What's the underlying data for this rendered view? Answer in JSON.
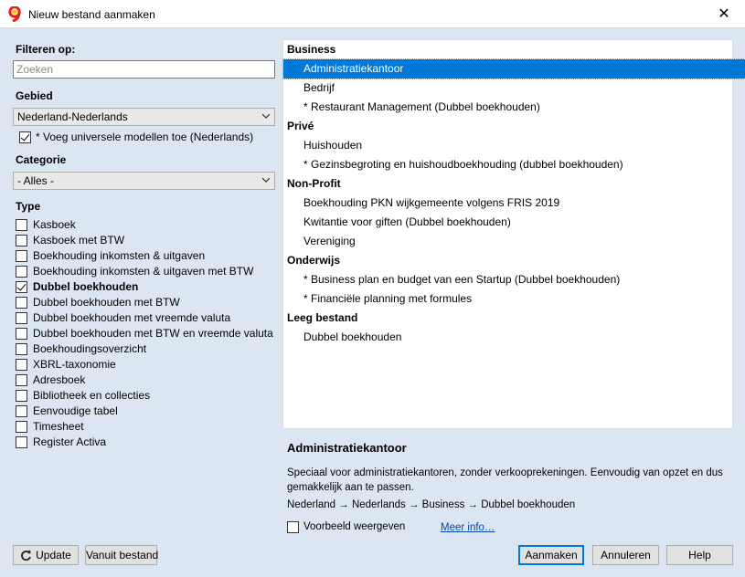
{
  "window": {
    "title": "Nieuw bestand aanmaken",
    "close_glyph": "✕"
  },
  "left": {
    "filter_label": "Filteren op:",
    "search_placeholder": "Zoeken",
    "area_label": "Gebied",
    "area_value": "Nederland-Nederlands",
    "universal_models": {
      "label": "* Voeg universele modellen toe (Nederlands)",
      "checked": true
    },
    "category_label": "Categorie",
    "category_value": "- Alles -",
    "type_label": "Type",
    "types": [
      {
        "label": "Kasboek",
        "checked": false
      },
      {
        "label": "Kasboek met BTW",
        "checked": false
      },
      {
        "label": "Boekhouding inkomsten & uitgaven",
        "checked": false
      },
      {
        "label": "Boekhouding inkomsten & uitgaven met BTW",
        "checked": false
      },
      {
        "label": "Dubbel boekhouden",
        "checked": true
      },
      {
        "label": "Dubbel boekhouden met BTW",
        "checked": false
      },
      {
        "label": "Dubbel boekhouden met vreemde valuta",
        "checked": false
      },
      {
        "label": "Dubbel boekhouden met BTW en vreemde valuta",
        "checked": false
      },
      {
        "label": "Boekhoudingsoverzicht",
        "checked": false
      },
      {
        "label": "XBRL-taxonomie",
        "checked": false
      },
      {
        "label": "Adresboek",
        "checked": false
      },
      {
        "label": "Bibliotheek en collecties",
        "checked": false
      },
      {
        "label": "Eenvoudige tabel",
        "checked": false
      },
      {
        "label": "Timesheet",
        "checked": false
      },
      {
        "label": "Register Activa",
        "checked": false
      }
    ]
  },
  "templates": [
    {
      "kind": "group",
      "label": "Business"
    },
    {
      "kind": "item",
      "label": "Administratiekantoor",
      "selected": true
    },
    {
      "kind": "item",
      "label": "Bedrijf"
    },
    {
      "kind": "item",
      "label": "* Restaurant Management (Dubbel boekhouden)"
    },
    {
      "kind": "group",
      "label": "Privé"
    },
    {
      "kind": "item",
      "label": "Huishouden"
    },
    {
      "kind": "item",
      "label": "* Gezinsbegroting en huishoudboekhouding (dubbel boekhouden)"
    },
    {
      "kind": "group",
      "label": "Non-Profit"
    },
    {
      "kind": "item",
      "label": "Boekhouding PKN wijkgemeente volgens FRIS 2019"
    },
    {
      "kind": "item",
      "label": "Kwitantie voor giften (Dubbel boekhouden)"
    },
    {
      "kind": "item",
      "label": "Vereniging"
    },
    {
      "kind": "group",
      "label": "Onderwijs"
    },
    {
      "kind": "item",
      "label": "* Business plan en budget van een Startup (Dubbel boekhouden)"
    },
    {
      "kind": "item",
      "label": "* Financiële planning met formules"
    },
    {
      "kind": "group",
      "label": "Leeg bestand"
    },
    {
      "kind": "item",
      "label": "Dubbel boekhouden"
    }
  ],
  "details": {
    "title": "Administratiekantoor",
    "description": "Speciaal voor administratiekantoren, zonder verkooprekeningen. Eenvoudig van opzet en dus gemakkelijk aan te passen.",
    "path": "Nederland → Nederlands → Business → Dubbel boekhouden",
    "preview_label": "Voorbeeld weergeven",
    "preview_checked": false,
    "more_info": "Meer info…"
  },
  "buttons": {
    "update": "Update",
    "from_file": "Vanuit bestand",
    "create": "Aanmaken",
    "cancel": "Annuleren",
    "help": "Help"
  },
  "colors": {
    "selection": "#0078d7",
    "background": "#dce6f3",
    "link": "#0645ad"
  }
}
